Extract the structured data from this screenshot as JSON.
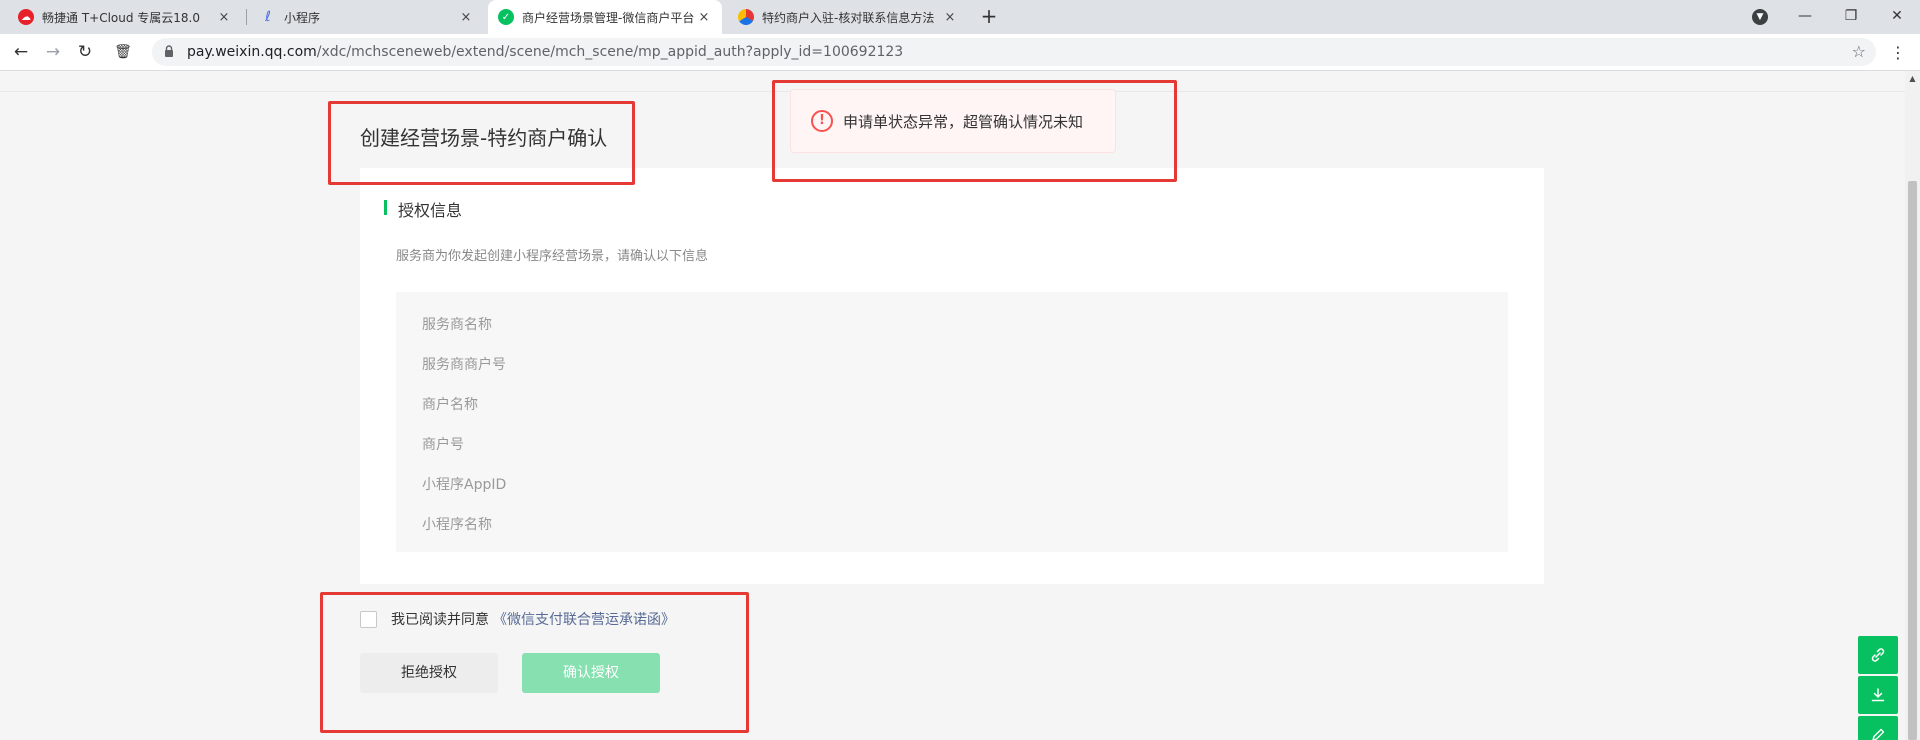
{
  "browser": {
    "tabs": [
      {
        "title": "畅捷通 T+Cloud 专属云18.0",
        "favicon": "red-cloud-icon",
        "favicon_color": "#e6212a",
        "active": false
      },
      {
        "title": "小程序",
        "favicon": "link-icon",
        "favicon_color": "#4a6ee0",
        "active": false
      },
      {
        "title": "商户经营场景管理-微信商户平台",
        "favicon": "wechat-icon",
        "favicon_color": "#07c160",
        "active": true
      },
      {
        "title": "特约商户入驻-核对联系信息方法",
        "favicon": "colorful-logo-icon",
        "favicon_color": "#1a73e8",
        "active": false
      }
    ],
    "close_glyph": "×",
    "new_tab_glyph": "+",
    "window_controls": {
      "minimize": "—",
      "restore": "❐",
      "close": "✕"
    },
    "toolbar": {
      "back": "←",
      "forward": "→",
      "reload": "↻",
      "trash": "🗑",
      "url_host": "pay.weixin.qq.com",
      "url_path": "/xdc/mchsceneweb/extend/scene/mch_scene/mp_appid_auth?apply_id=100692123",
      "star": "☆",
      "menu": "⋮"
    }
  },
  "page": {
    "title": "创建经营场景-特约商户确认",
    "toast": {
      "icon": "!",
      "message": "申请单状态异常，超管确认情况未知",
      "color": "#fa5151"
    },
    "section": {
      "title": "授权信息",
      "description": "服务商为你发起创建小程序经营场景，请确认以下信息",
      "fields": [
        "服务商名称",
        "服务商商户号",
        "商户名称",
        "商户号",
        "小程序AppID",
        "小程序名称"
      ]
    },
    "agreement": {
      "text": "我已阅读并同意",
      "link": "《微信支付联合营运承诺函》",
      "checked": false
    },
    "buttons": {
      "reject": "拒绝授权",
      "confirm": "确认授权"
    },
    "floating": [
      "link-icon",
      "download-icon",
      "edit-icon"
    ],
    "accent_color": "#07c160"
  }
}
